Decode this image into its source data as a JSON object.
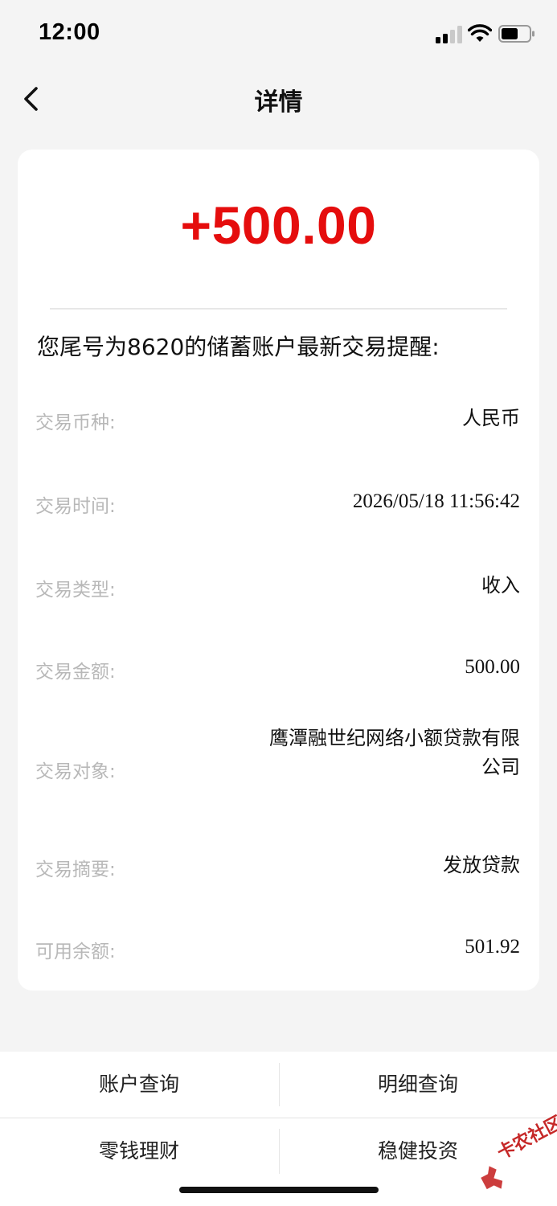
{
  "status_bar": {
    "time": "12:00",
    "icons": [
      "signal-icon",
      "wifi-icon",
      "battery-icon"
    ]
  },
  "nav": {
    "back_icon": "chevron-left-icon",
    "title": "详情"
  },
  "detail": {
    "amount": "+500.00",
    "amount_color": "#e50d0d",
    "notice": "您尾号为8620的储蓄账户最新交易提醒:",
    "rows": [
      {
        "label": "交易币种:",
        "value": "人民币"
      },
      {
        "label": "交易时间:",
        "value": "2026/05/18 11:56:42"
      },
      {
        "label": "交易类型:",
        "value": "收入"
      },
      {
        "label": "交易金额:",
        "value": "500.00"
      },
      {
        "label": "交易对象:",
        "value_line1": "鹰潭融世纪网络小额贷款有限",
        "value_line2": "公司"
      },
      {
        "label": "交易摘要:",
        "value": "发放贷款"
      },
      {
        "label": "可用余额:",
        "value": "501.92"
      }
    ]
  },
  "bottom_menu": {
    "items": [
      "账户查询",
      "明细查询",
      "零钱理财",
      "稳健投资"
    ]
  },
  "watermark": {
    "text": "卡农社区",
    "color": "#c62828"
  }
}
